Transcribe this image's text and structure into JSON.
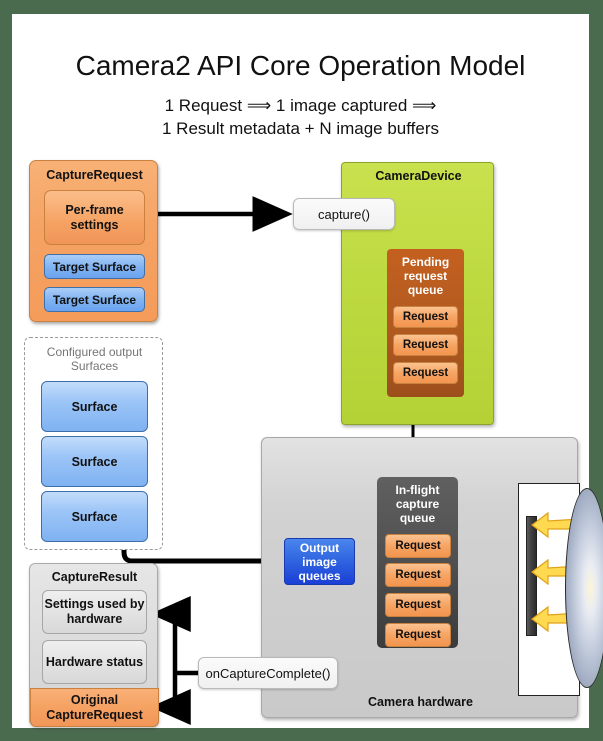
{
  "header": {
    "title": "Camera2 API Core Operation Model",
    "subtitle_line1": "1 Request ⟹ 1 image captured ⟹",
    "subtitle_line2": "1 Result metadata + N image buffers"
  },
  "capture_request": {
    "title": "CaptureRequest",
    "per_frame_settings": "Per-frame settings",
    "target_surfaces": [
      "Target Surface",
      "Target Surface"
    ]
  },
  "configured_surfaces": {
    "label": "Configured output Surfaces",
    "items": [
      "Surface",
      "Surface",
      "Surface"
    ]
  },
  "camera_device": {
    "title": "CameraDevice",
    "pending_queue": {
      "title": "Pending request queue",
      "requests": [
        "Request",
        "Request",
        "Request"
      ]
    }
  },
  "callouts": {
    "capture": "capture()",
    "on_capture_complete": "onCaptureComplete()"
  },
  "camera_hardware": {
    "label": "Camera hardware",
    "in_flight_queue": {
      "title": "In-flight capture queue",
      "requests": [
        "Request",
        "Request",
        "Request",
        "Request"
      ]
    },
    "output_image_queues": "Output image queues"
  },
  "capture_result": {
    "title": "CaptureResult",
    "settings_used": "Settings used by hardware",
    "hardware_status": "Hardware status",
    "original_request": "Original CaptureRequest"
  },
  "colors": {
    "page_border": "#4b6b4f",
    "canvas": "#ffffff",
    "capture_request_orange": "#f5a263",
    "target_surface_blue": "#7eb2f2",
    "camera_device_green": "#bcd93f",
    "pending_queue_brown": "#b05a20",
    "in_flight_dark_gray": "#4f4f4f",
    "output_queues_blue": "#2f63e0",
    "camera_hardware_gray": "#d2d2d2",
    "capture_result_gray": "#dcdcdc",
    "light_ray_yellow": "#ffd34f",
    "callout_gray": "#f0f0f0"
  }
}
